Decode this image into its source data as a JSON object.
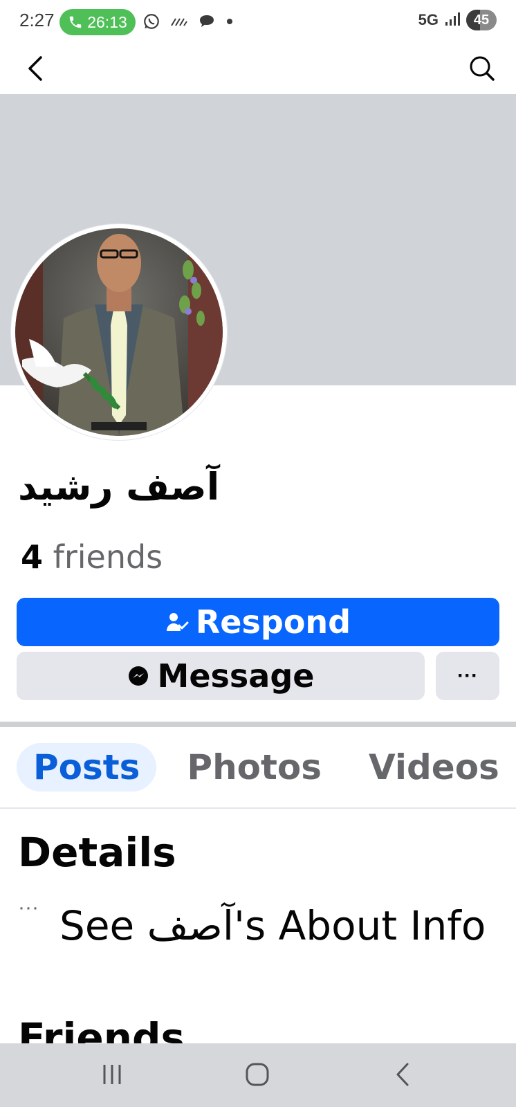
{
  "status_bar": {
    "time": "2:27",
    "call_timer": "26:13",
    "network": "5G",
    "battery": "45",
    "icons": [
      "phone-icon",
      "whatsapp-icon",
      "signal-wifi-icon",
      "chat-bubble-icon",
      "dot-icon",
      "signal-bars-icon"
    ]
  },
  "header": {
    "back_icon": "back-arrow-icon",
    "search_icon": "search-icon"
  },
  "profile": {
    "name": "آصف رشيد",
    "friends_count": "4",
    "friends_label": "friends"
  },
  "actions": {
    "respond_label": "Respond",
    "message_label": "Message",
    "more_label": "···"
  },
  "tabs": [
    {
      "label": "Posts",
      "active": true
    },
    {
      "label": "Photos",
      "active": false
    },
    {
      "label": "Videos",
      "active": false
    }
  ],
  "details": {
    "heading": "Details",
    "about_link": "See آصف's About Info",
    "dots": "···"
  },
  "friends_section": {
    "heading": "Friends"
  },
  "colors": {
    "primary_blue": "#0866ff",
    "secondary_gray": "#e4e6eb",
    "cover_gray": "#d0d3d8",
    "call_green": "#4fbf57"
  }
}
